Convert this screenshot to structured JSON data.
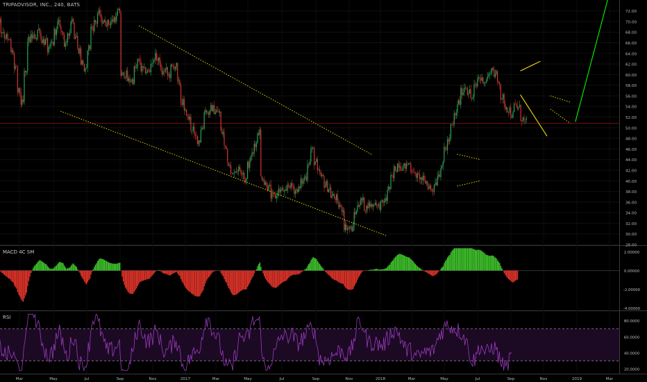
{
  "header": {
    "title": "TRIPADVISOR, INC., 240, BATS"
  },
  "panels": {
    "macd_label": "MACD 4C SM",
    "rsi_label": "RSI"
  },
  "chart_data": [
    {
      "type": "candlestick",
      "title": "TRIPADVISOR, INC., 240, BATS",
      "ylim": [
        28,
        73
      ],
      "y_ticks": [
        "72.00",
        "70.00",
        "68.00",
        "66.00",
        "64.00",
        "62.00",
        "60.00",
        "58.00",
        "56.00",
        "54.00",
        "52.00",
        "50.00",
        "48.00",
        "46.00",
        "44.00",
        "42.00",
        "40.00",
        "38.00",
        "36.00",
        "34.00",
        "32.00",
        "30.00",
        "28.00"
      ],
      "x_ticks": [
        "Mar",
        "May",
        "Jul",
        "Sep",
        "Nov",
        "2017",
        "Mar",
        "May",
        "Jul",
        "Sep",
        "Nov",
        "2018",
        "Mar",
        "May",
        "Jul",
        "Sep",
        "Nov",
        "2019",
        "Mar"
      ],
      "current_level": 50.8,
      "price_path": [
        [
          0,
          70
        ],
        [
          4,
          64
        ],
        [
          7,
          54
        ],
        [
          9,
          66
        ],
        [
          12,
          68
        ],
        [
          15,
          65
        ],
        [
          18,
          69
        ],
        [
          20,
          66
        ],
        [
          22,
          70
        ],
        [
          26,
          60
        ],
        [
          28,
          69
        ],
        [
          30,
          71
        ],
        [
          33,
          70
        ],
        [
          36,
          71
        ],
        [
          37,
          60
        ],
        [
          40,
          59
        ],
        [
          42,
          62
        ],
        [
          45,
          60
        ],
        [
          47,
          64
        ],
        [
          49,
          61
        ],
        [
          51,
          60
        ],
        [
          53,
          62
        ],
        [
          55,
          55
        ],
        [
          57,
          51
        ],
        [
          60,
          48
        ],
        [
          62,
          53
        ],
        [
          64,
          54
        ],
        [
          66,
          53
        ],
        [
          68,
          46
        ],
        [
          70,
          41
        ],
        [
          72,
          42
        ],
        [
          74,
          41
        ],
        [
          76,
          45
        ],
        [
          78,
          49
        ],
        [
          79,
          41
        ],
        [
          81,
          38
        ],
        [
          83,
          37
        ],
        [
          85,
          38
        ],
        [
          87,
          39
        ],
        [
          90,
          38
        ],
        [
          92,
          41
        ],
        [
          94,
          45
        ],
        [
          96,
          42
        ],
        [
          98,
          39
        ],
        [
          100,
          37
        ],
        [
          102,
          36
        ],
        [
          104,
          32
        ],
        [
          106,
          31
        ],
        [
          108,
          36
        ],
        [
          111,
          35
        ],
        [
          113,
          36
        ],
        [
          116,
          36
        ],
        [
          118,
          40
        ],
        [
          120,
          43
        ],
        [
          121,
          42
        ],
        [
          123,
          44
        ],
        [
          125,
          41
        ],
        [
          127,
          40
        ],
        [
          129,
          39
        ],
        [
          130,
          38
        ],
        [
          131,
          39
        ],
        [
          132,
          41
        ],
        [
          134,
          46
        ],
        [
          136,
          50
        ],
        [
          138,
          55
        ],
        [
          140,
          58
        ],
        [
          142,
          56
        ],
        [
          144,
          60
        ],
        [
          146,
          58
        ],
        [
          148,
          61
        ],
        [
          150,
          58
        ],
        [
          152,
          54
        ],
        [
          154,
          53
        ],
        [
          156,
          54
        ],
        [
          158,
          51
        ]
      ],
      "overlay_lines": [
        {
          "color": "#e6d400",
          "style": "dotted",
          "points": [
            [
              42.5,
              69.2
            ],
            [
              112.5,
              44.9
            ]
          ]
        },
        {
          "color": "#e6d400",
          "style": "dotted",
          "points": [
            [
              19,
              53.1
            ],
            [
              117,
              29.6
            ]
          ]
        },
        {
          "color": "#e6d400",
          "style": "dotted",
          "points": [
            [
              138,
              45
            ],
            [
              145,
              44
            ]
          ]
        },
        {
          "color": "#e6d400",
          "style": "dotted",
          "points": [
            [
              138,
              39
            ],
            [
              145,
              40
            ]
          ]
        },
        {
          "color": "#e6d400",
          "style": "solid",
          "points": [
            [
              157,
              60.7
            ],
            [
              163,
              62.5
            ]
          ]
        },
        {
          "color": "#e6d400",
          "style": "solid",
          "points": [
            [
              157,
              56.2
            ],
            [
              165,
              48.4
            ]
          ]
        },
        {
          "color": "#e6d400",
          "style": "dotted",
          "points": [
            [
              166,
              56
            ],
            [
              172,
              54.8
            ]
          ]
        },
        {
          "color": "#e6d400",
          "style": "dotted",
          "points": [
            [
              166,
              53.5
            ],
            [
              172,
              50.8
            ]
          ]
        },
        {
          "color": "#00e600",
          "style": "solid",
          "points": [
            [
              173.5,
              51.1
            ],
            [
              184,
              76
            ]
          ]
        }
      ]
    },
    {
      "type": "bar",
      "title": "MACD 4C SM",
      "ylim": [
        -4.2,
        2.5
      ],
      "y_ticks": [
        "2.00000",
        "0.00000",
        "-2.00000",
        "-4.00000"
      ],
      "note": "green histogram above zero, red below zero"
    },
    {
      "type": "line",
      "title": "RSI",
      "ylim": [
        15,
        90
      ],
      "y_ticks": [
        "80.0000",
        "60.0000",
        "40.0000",
        "20.0000"
      ],
      "bands": [
        30,
        70
      ]
    }
  ]
}
